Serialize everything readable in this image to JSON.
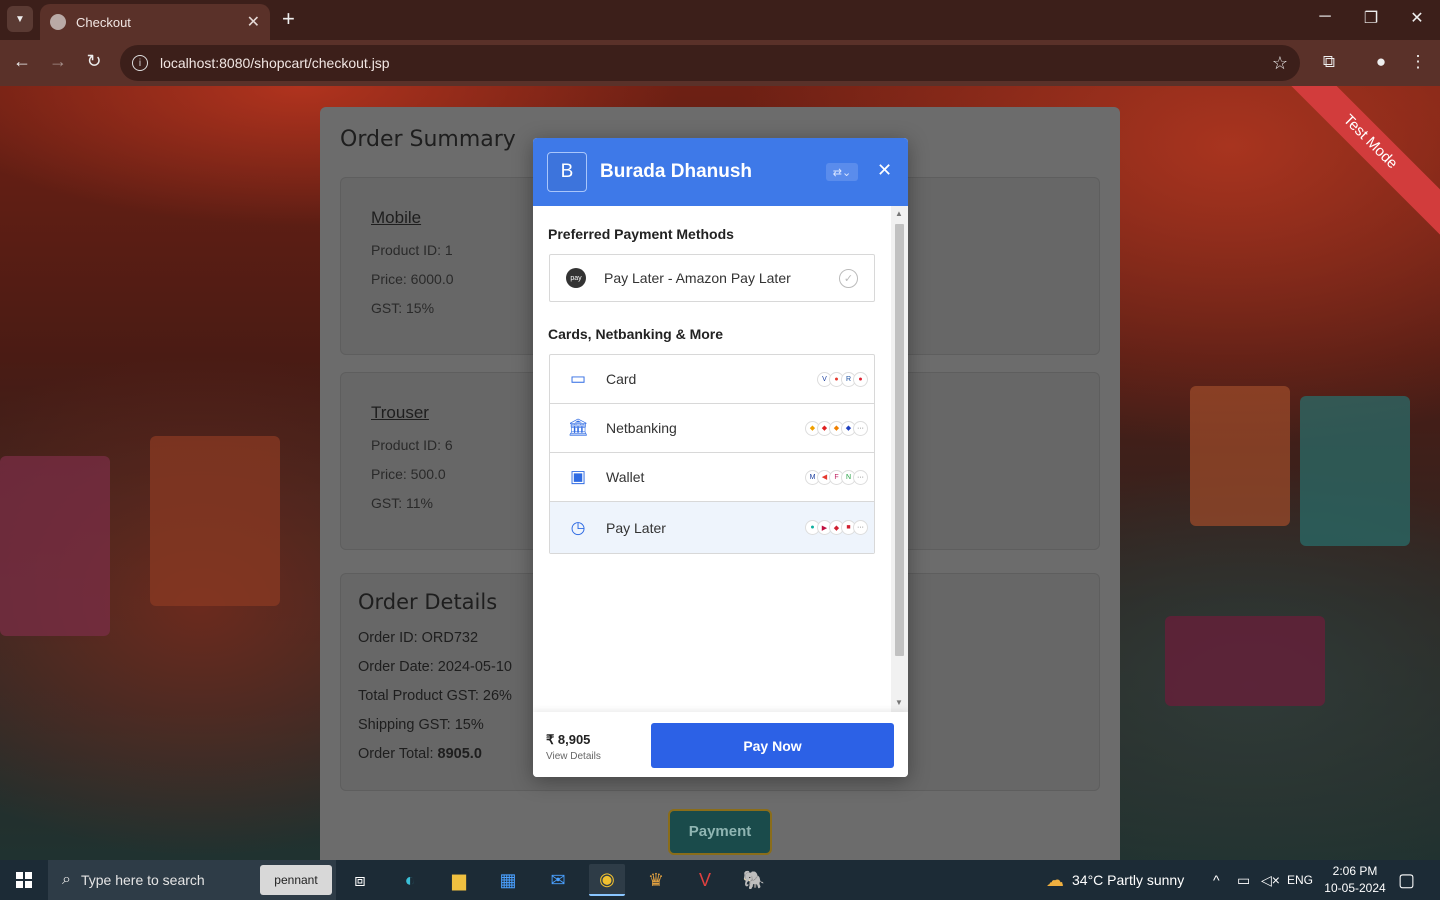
{
  "browser": {
    "tab_title": "Checkout",
    "url": "localhost:8080/shopcart/checkout.jsp"
  },
  "page": {
    "ribbon": "Test Mode",
    "order_summary_title": "Order Summary",
    "products": [
      {
        "name": "Mobile",
        "product_id": "Product ID: 1",
        "price": "Price: 6000.0",
        "gst": "GST: 15%"
      },
      {
        "name": "Trouser",
        "product_id": "Product ID: 6",
        "price": "Price: 500.0",
        "gst": "GST: 11%"
      }
    ],
    "order_details": {
      "title": "Order Details",
      "order_id": "Order ID: ORD732",
      "order_date": "Order Date: 2024-05-10",
      "product_gst": "Total Product GST: 26%",
      "shipping_gst": "Shipping GST: 15%",
      "total_label": "Order Total: ",
      "total_value": "8905.0"
    },
    "payment_button": "Payment"
  },
  "modal": {
    "logo_letter": "B",
    "merchant_name": "Burada Dhanush",
    "preferred_title": "Preferred Payment Methods",
    "preferred_method": "Pay Later - Amazon Pay Later",
    "preferred_icon_text": "pay",
    "cards_title": "Cards, Netbanking & More",
    "methods": [
      {
        "label": "Card",
        "icon": "card-icon"
      },
      {
        "label": "Netbanking",
        "icon": "bank-icon"
      },
      {
        "label": "Wallet",
        "icon": "wallet-icon"
      },
      {
        "label": "Pay Later",
        "icon": "pay-later-icon"
      }
    ],
    "amount": "₹ 8,905",
    "view_details": "View Details",
    "pay_now": "Pay Now"
  },
  "taskbar": {
    "search_placeholder": "Type here to search",
    "pennant": "pennant",
    "weather": "34°C  Partly sunny",
    "lang": "ENG",
    "time": "2:06 PM",
    "date": "10-05-2024"
  },
  "colors": {
    "modal_header": "#3e79e8",
    "pay_now": "#2c61e6",
    "ribbon": "#d23c3c"
  }
}
